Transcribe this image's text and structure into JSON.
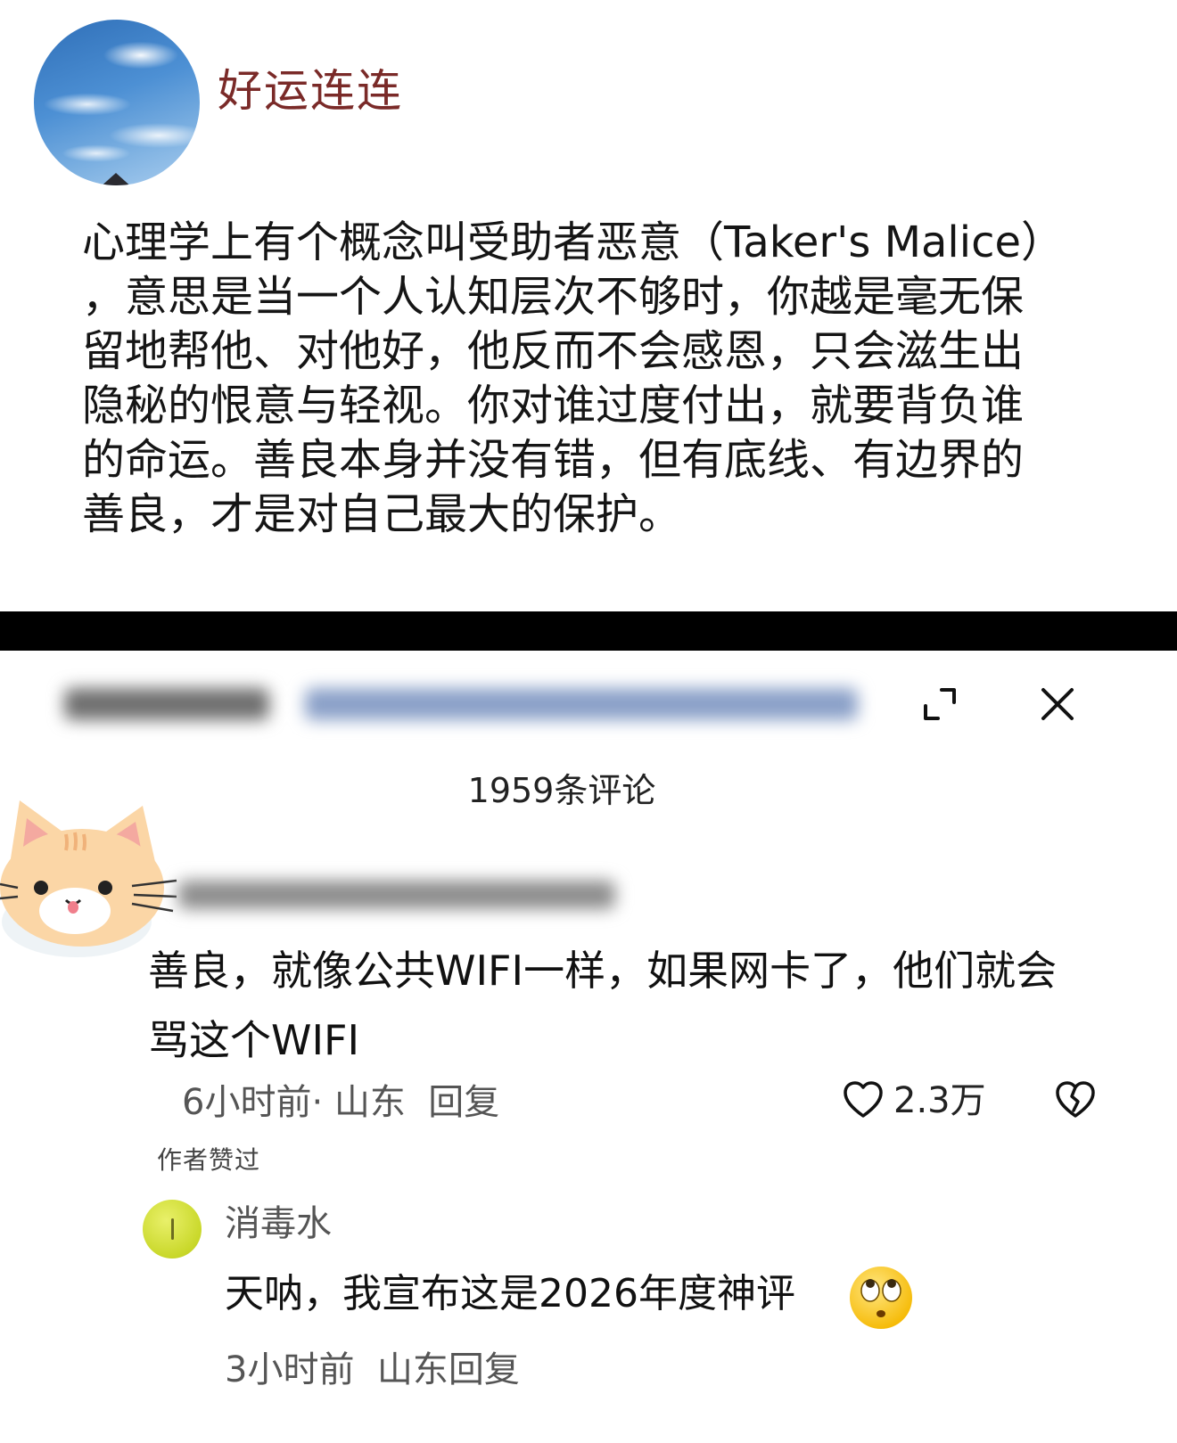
{
  "post": {
    "author": "好运连连",
    "body": "心理学上有个概念叫受助者恶意（Taker's Malice）\n，意思是当一个人认知层次不够时，你越是毫无保\n留地帮他、对他好，他反而不会感恩，只会滋生出\n隐秘的恨意与轻视。你对谁过度付出，就要背负谁\n的命运。善良本身并没有错，但有底线、有边界的\n善良，才是对自己最大的保护。"
  },
  "comments_header": {
    "count_label": "1959条评论"
  },
  "top_comment": {
    "text": "善良，就像公共WIFI一样，如果网卡了，他们就会\n骂这个WIFI",
    "meta": "6小时前· 山东  回复",
    "likes": "2.3万",
    "author_liked_badge": "作者赞过"
  },
  "reply": {
    "username": "消毒水",
    "text": "天呐，我宣布这是2026年度神评",
    "meta": "3小时前  山东回复"
  },
  "icons": {
    "expand": "expand-icon",
    "close": "close-icon",
    "like": "heart-icon",
    "dislike": "broken-heart-icon",
    "emoji": "eye-roll-emoji"
  },
  "colors": {
    "author_name": "#7a2a28",
    "divider": "#000000",
    "reply_avatar": "#c9d82a"
  }
}
